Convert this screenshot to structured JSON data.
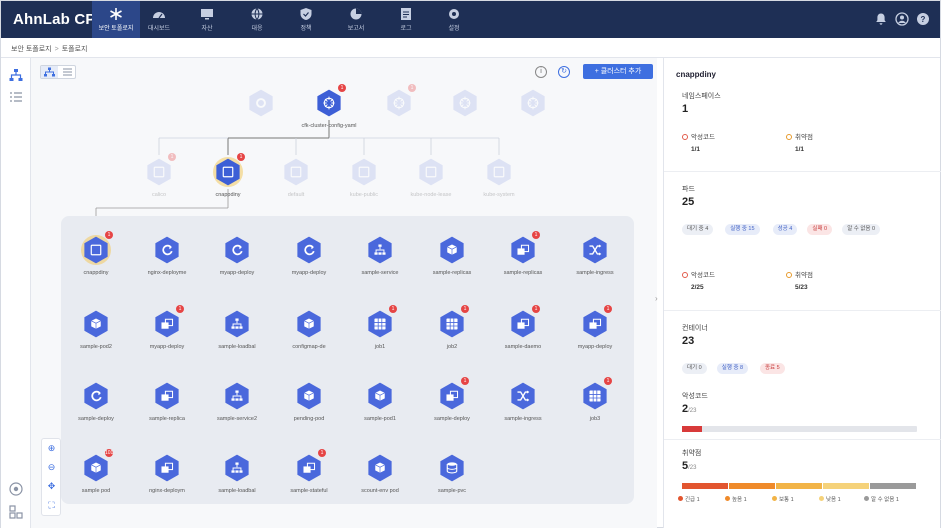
{
  "app": {
    "title": "AhnLab CPP"
  },
  "nav": [
    {
      "label": "보안 토폴로지",
      "icon": "asterisk-icon",
      "active": true
    },
    {
      "label": "대시보드",
      "icon": "dashboard-icon",
      "active": false
    },
    {
      "label": "자산",
      "icon": "monitor-icon",
      "active": false
    },
    {
      "label": "대응",
      "icon": "globe-icon",
      "active": false
    },
    {
      "label": "정책",
      "icon": "shield-icon",
      "active": false
    },
    {
      "label": "보고서",
      "icon": "pie-chart-icon",
      "active": false
    },
    {
      "label": "로그",
      "icon": "document-icon",
      "active": false
    },
    {
      "label": "설정",
      "icon": "gear-icon",
      "active": false
    }
  ],
  "breadcrumb": {
    "parent": "보안 토폴로지",
    "current": "토폴로지"
  },
  "toolbar": {
    "add_button": "+ 클러스터 추가",
    "info": "i",
    "refresh": "↻"
  },
  "top_nodes": [
    {
      "label": "",
      "badge": "",
      "faded": true,
      "kind": "gear"
    },
    {
      "label": "cfk-cluster-config-yaml",
      "badge": "1",
      "faded": false,
      "kind": "k8s"
    },
    {
      "label": "",
      "badge": "1",
      "faded": true,
      "kind": "k8s"
    },
    {
      "label": "",
      "badge": "",
      "faded": true,
      "kind": "k8s"
    },
    {
      "label": "",
      "badge": "",
      "faded": true,
      "kind": "k8s"
    }
  ],
  "ns_nodes": [
    {
      "label": "calico",
      "badge": "1",
      "faded": true
    },
    {
      "label": "cnappdiny",
      "badge": "1",
      "faded": false,
      "selected": true
    },
    {
      "label": "default",
      "badge": "",
      "faded": true
    },
    {
      "label": "kube-public",
      "badge": "",
      "faded": true
    },
    {
      "label": "kube-node-lease",
      "badge": "",
      "faded": true
    },
    {
      "label": "kube-system",
      "badge": "",
      "faded": true
    }
  ],
  "workload_nodes": [
    {
      "label": "cnappdiny",
      "kind": "namespace",
      "badge": "1",
      "selected": true
    },
    {
      "label": "nginx-deployme",
      "kind": "deploy",
      "badge": ""
    },
    {
      "label": "myapp-deploy",
      "kind": "deploy",
      "badge": ""
    },
    {
      "label": "myapp-deploy",
      "kind": "deploy",
      "badge": ""
    },
    {
      "label": "sample-service",
      "kind": "service",
      "badge": ""
    },
    {
      "label": "sample-replicas",
      "kind": "box",
      "badge": ""
    },
    {
      "label": "sample-replicas",
      "kind": "boxes",
      "badge": "1"
    },
    {
      "label": "sample-ingress",
      "kind": "shuffle",
      "badge": ""
    },
    {
      "label": "sample-pod2",
      "kind": "box",
      "badge": ""
    },
    {
      "label": "myapp-deploy",
      "kind": "boxes",
      "badge": "1"
    },
    {
      "label": "sample-loadbal",
      "kind": "service",
      "badge": ""
    },
    {
      "label": "configmap-de",
      "kind": "box",
      "badge": ""
    },
    {
      "label": "job1",
      "kind": "grid",
      "badge": "1"
    },
    {
      "label": "job2",
      "kind": "grid",
      "badge": "1"
    },
    {
      "label": "sample-daemo",
      "kind": "boxes",
      "badge": "1"
    },
    {
      "label": "myapp-deploy",
      "kind": "boxes",
      "badge": "1"
    },
    {
      "label": "sample-deploy",
      "kind": "deploy",
      "badge": ""
    },
    {
      "label": "sample-replica",
      "kind": "boxes",
      "badge": ""
    },
    {
      "label": "sample-service2",
      "kind": "service",
      "badge": ""
    },
    {
      "label": "pending-pod",
      "kind": "box",
      "badge": ""
    },
    {
      "label": "sample-pod1",
      "kind": "box",
      "badge": ""
    },
    {
      "label": "sample-deploy",
      "kind": "boxes",
      "badge": "1"
    },
    {
      "label": "sample-ingress",
      "kind": "shuffle",
      "badge": ""
    },
    {
      "label": "job3",
      "kind": "grid",
      "badge": "1"
    },
    {
      "label": "sample pod",
      "kind": "box",
      "badge": "101"
    },
    {
      "label": "nginx-deploym",
      "kind": "boxes",
      "badge": ""
    },
    {
      "label": "sample-loadbal",
      "kind": "service",
      "badge": ""
    },
    {
      "label": "sample-stateful",
      "kind": "boxes",
      "badge": "1"
    },
    {
      "label": "scount-env pod",
      "kind": "box",
      "badge": ""
    },
    {
      "label": "sample-pvc",
      "kind": "pvc",
      "badge": ""
    }
  ],
  "panel": {
    "title": "cnappdiny",
    "namespace": {
      "label": "네임스페이스",
      "count": "1",
      "vuln_label": "악성코드",
      "vuln_value": "1/1",
      "weak_label": "취약점",
      "weak_value": "1/1"
    },
    "pods": {
      "label": "파드",
      "count": "25",
      "chips": [
        {
          "text": "대기 중 4",
          "tone": ""
        },
        {
          "text": "실행 중 15",
          "tone": "info"
        },
        {
          "text": "성공 4",
          "tone": "info"
        },
        {
          "text": "실패 0",
          "tone": "err"
        },
        {
          "text": "알 수 없음 0",
          "tone": ""
        }
      ],
      "vuln_label": "악성코드",
      "vuln_value": "2/25",
      "weak_label": "취약점",
      "weak_value": "5/23"
    },
    "containers": {
      "label": "컨테이너",
      "count": "23",
      "chips": [
        {
          "text": "대기 0",
          "tone": ""
        },
        {
          "text": "실행 중 8",
          "tone": "info"
        },
        {
          "text": "종료 5",
          "tone": "err"
        }
      ]
    },
    "malware": {
      "label": "악성코드",
      "value": "2",
      "total": "/23",
      "fraction": 0.087
    },
    "vulnerability": {
      "label": "취약점",
      "value": "5",
      "total": "/23",
      "legend": [
        {
          "text": "긴급 1",
          "color": "#e2552f"
        },
        {
          "text": "높음 1",
          "color": "#ef8a2a"
        },
        {
          "text": "보통 1",
          "color": "#f2b447"
        },
        {
          "text": "낮음 1",
          "color": "#f5d27a"
        },
        {
          "text": "알 수 없음 1",
          "color": "#9a9a9a"
        }
      ]
    }
  },
  "colors": {
    "nav_bg": "#1e2f55",
    "accent": "#3e6fe0",
    "node": "#4a68dc",
    "selected_ring": "#f3c95e",
    "badge": "#e64545"
  }
}
